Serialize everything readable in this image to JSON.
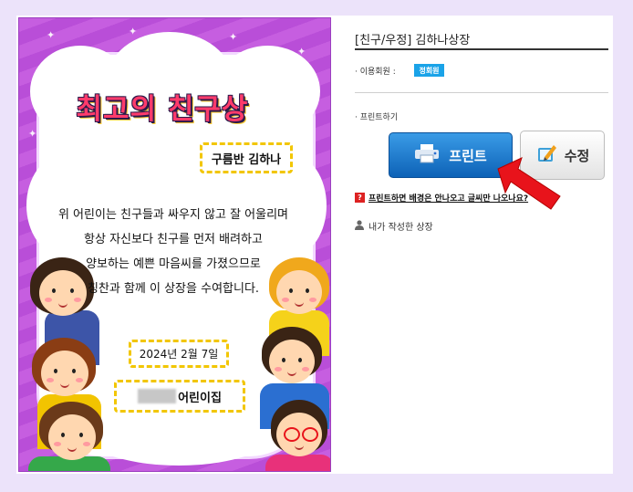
{
  "certificate": {
    "title": "최고의 친구상",
    "recipient": "구름반 김하나",
    "body_lines": [
      "위 어린이는 친구들과 싸우지 않고 잘 어울리며",
      "항상 자신보다 친구를 먼저 배려하고",
      "양보하는 예쁜 마음씨를 가졌으므로",
      "칭찬과 함께 이 상장을 수여합니다."
    ],
    "date": "2024년 2월 7일",
    "school_suffix": "어린이집"
  },
  "panel": {
    "title": "[친구/우정] 김하나상장",
    "member_label": "· 이용회원 :",
    "member_badge": "정회원",
    "print_section_label": "· 프린트하기",
    "print_button": "프린트",
    "edit_button": "수정",
    "help_text": "프린트하면 배경은 안나오고 글씨만 나오나요?",
    "my_awards": "내가 작성한 상장"
  },
  "colors": {
    "page_bg": "#ece3fa",
    "cert_purple": "#c65ee0",
    "badge_blue": "#1aa3e8",
    "print_blue": "#0d62b7",
    "arrow_red": "#e8131b",
    "dash_yellow": "#f2c600"
  }
}
